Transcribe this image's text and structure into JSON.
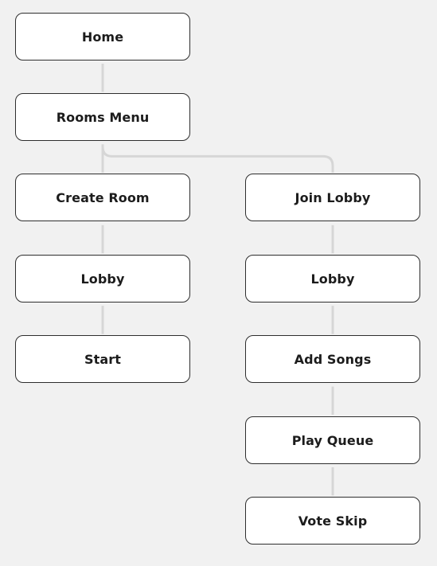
{
  "diagram": {
    "type": "flowchart-tree",
    "colors": {
      "background": "#f1f1f1",
      "node_fill": "#ffffff",
      "node_border": "#2e2e2e",
      "connector": "#d6d6d6",
      "text": "#1c1c1c"
    },
    "nodes": [
      {
        "id": "home",
        "label": "Home",
        "column": "left",
        "row": 0
      },
      {
        "id": "rooms-menu",
        "label": "Rooms Menu",
        "column": "left",
        "row": 1
      },
      {
        "id": "create-room",
        "label": "Create Room",
        "column": "left",
        "row": 2
      },
      {
        "id": "lobby-host",
        "label": "Lobby",
        "column": "left",
        "row": 3
      },
      {
        "id": "start",
        "label": "Start",
        "column": "left",
        "row": 4
      },
      {
        "id": "join-lobby",
        "label": "Join Lobby",
        "column": "right",
        "row": 2
      },
      {
        "id": "lobby-guest",
        "label": "Lobby",
        "column": "right",
        "row": 3
      },
      {
        "id": "add-songs",
        "label": "Add Songs",
        "column": "right",
        "row": 4
      },
      {
        "id": "play-queue",
        "label": "Play Queue",
        "column": "right",
        "row": 5
      },
      {
        "id": "vote-skip",
        "label": "Vote Skip",
        "column": "right",
        "row": 6
      }
    ],
    "edges": [
      {
        "from": "home",
        "to": "rooms-menu"
      },
      {
        "from": "rooms-menu",
        "to": "create-room"
      },
      {
        "from": "rooms-menu",
        "to": "join-lobby"
      },
      {
        "from": "create-room",
        "to": "lobby-host"
      },
      {
        "from": "lobby-host",
        "to": "start"
      },
      {
        "from": "join-lobby",
        "to": "lobby-guest"
      },
      {
        "from": "lobby-guest",
        "to": "add-songs"
      },
      {
        "from": "add-songs",
        "to": "play-queue"
      },
      {
        "from": "play-queue",
        "to": "vote-skip"
      }
    ]
  }
}
